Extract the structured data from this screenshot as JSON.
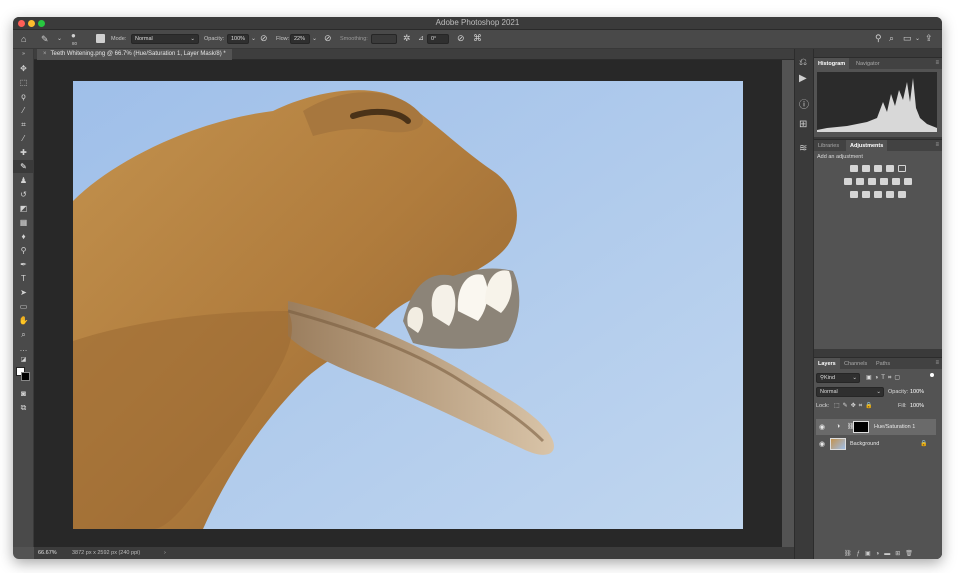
{
  "window": {
    "title": "Adobe Photoshop 2021"
  },
  "options_bar": {
    "brush_size": "80",
    "mode_label": "Mode:",
    "mode_value": "Normal",
    "opacity_label": "Opacity:",
    "opacity_value": "100%",
    "flow_label": "Flow:",
    "flow_value": "22%",
    "smoothing_label": "Smoothing:",
    "angle_value": "0°"
  },
  "document": {
    "tab_title": "Teeth Whitening.png @ 66.7% (Hue/Saturation 1, Layer Mask/8) *"
  },
  "status": {
    "zoom": "66.67%",
    "doc_info": "3872 px x 2592 px (240 ppi)"
  },
  "histogram_panel": {
    "tabs": [
      "Histogram",
      "Navigator"
    ],
    "active": "Histogram"
  },
  "adjustments_panel": {
    "tabs": [
      "Libraries",
      "Adjustments"
    ],
    "active": "Adjustments",
    "heading": "Add an adjustment"
  },
  "layers_panel": {
    "tabs": [
      "Layers",
      "Channels",
      "Paths"
    ],
    "active": "Layers",
    "filter_kind": "Kind",
    "blend_mode": "Normal",
    "opacity_label": "Opacity:",
    "opacity_value": "100%",
    "lock_label": "Lock:",
    "fill_label": "Fill:",
    "fill_value": "100%",
    "layers": [
      {
        "name": "Hue/Saturation 1",
        "selected": true
      },
      {
        "name": "Background",
        "selected": false
      }
    ]
  },
  "colors": {
    "accent": "#2f7bdc",
    "sky": "#a9c6ea",
    "fur": "#b98a4e"
  }
}
